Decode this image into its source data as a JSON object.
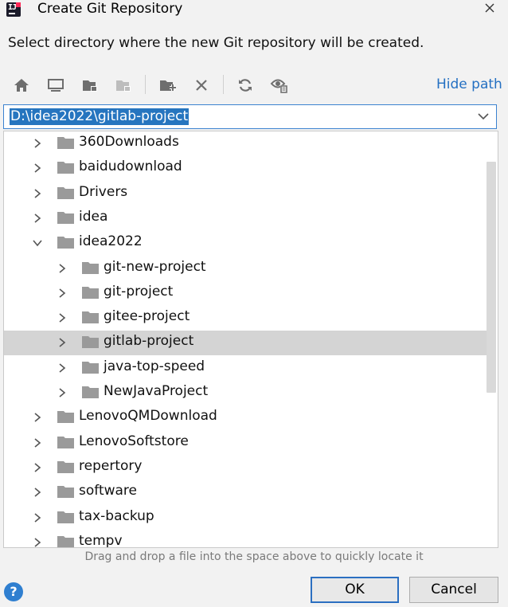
{
  "window": {
    "title": "Create Git Repository"
  },
  "subtitle": "Select directory where the new Git repository will be created.",
  "toolbar": {
    "icons": [
      "home-icon",
      "desktop-icon",
      "project-folder-icon",
      "module-folder-icon",
      "new-folder-icon",
      "delete-icon",
      "refresh-icon",
      "show-hidden-icon"
    ],
    "hide_path_label": "Hide path"
  },
  "path": {
    "value": "D:\\idea2022\\gitlab-project"
  },
  "tree": {
    "items": [
      {
        "label": "360Downloads",
        "level": 0,
        "expanded": false,
        "selected": false
      },
      {
        "label": "baidudownload",
        "level": 0,
        "expanded": false,
        "selected": false
      },
      {
        "label": "Drivers",
        "level": 0,
        "expanded": false,
        "selected": false
      },
      {
        "label": "idea",
        "level": 0,
        "expanded": false,
        "selected": false
      },
      {
        "label": "idea2022",
        "level": 0,
        "expanded": true,
        "selected": false
      },
      {
        "label": "git-new-project",
        "level": 1,
        "expanded": false,
        "selected": false
      },
      {
        "label": "git-project",
        "level": 1,
        "expanded": false,
        "selected": false
      },
      {
        "label": "gitee-project",
        "level": 1,
        "expanded": false,
        "selected": false
      },
      {
        "label": "gitlab-project",
        "level": 1,
        "expanded": false,
        "selected": true
      },
      {
        "label": "java-top-speed",
        "level": 1,
        "expanded": false,
        "selected": false
      },
      {
        "label": "NewJavaProject",
        "level": 1,
        "expanded": false,
        "selected": false
      },
      {
        "label": "LenovoQMDownload",
        "level": 0,
        "expanded": false,
        "selected": false
      },
      {
        "label": "LenovoSoftstore",
        "level": 0,
        "expanded": false,
        "selected": false
      },
      {
        "label": "repertory",
        "level": 0,
        "expanded": false,
        "selected": false
      },
      {
        "label": "software",
        "level": 0,
        "expanded": false,
        "selected": false
      },
      {
        "label": "tax-backup",
        "level": 0,
        "expanded": false,
        "selected": false
      },
      {
        "label": "tempv",
        "level": 0,
        "expanded": false,
        "selected": false
      }
    ]
  },
  "hint": "Drag and drop a file into the space above to quickly locate it",
  "buttons": {
    "help": "?",
    "ok": "OK",
    "cancel": "Cancel"
  },
  "colors": {
    "accent": "#2675bf",
    "link": "#2470c2",
    "selection": "#d4d4d4",
    "icon": "#6e6e6e"
  }
}
